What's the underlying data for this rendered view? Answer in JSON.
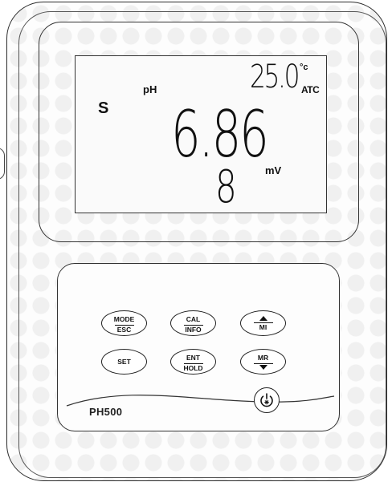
{
  "display": {
    "temperature": "25.0",
    "temperature_unit": "°c",
    "temperature_mode": "ATC",
    "ph_label": "pH",
    "ph_value": "6.86",
    "stability_indicator": "S",
    "mv_value": "8",
    "mv_unit": "mV"
  },
  "keypad": {
    "mode_esc": {
      "top": "MODE",
      "bottom": "ESC"
    },
    "cal_info": {
      "top": "CAL",
      "bottom": "INFO"
    },
    "up_mi": {
      "bottom": "MI",
      "icon": "arrow-up-icon"
    },
    "set": {
      "label": "SET"
    },
    "ent_hold": {
      "top": "ENT",
      "bottom": "HOLD"
    },
    "mr_down": {
      "top": "MR",
      "icon": "arrow-down-icon"
    },
    "power": {
      "icon": "power-icon"
    }
  },
  "device": {
    "model": "PH500"
  }
}
